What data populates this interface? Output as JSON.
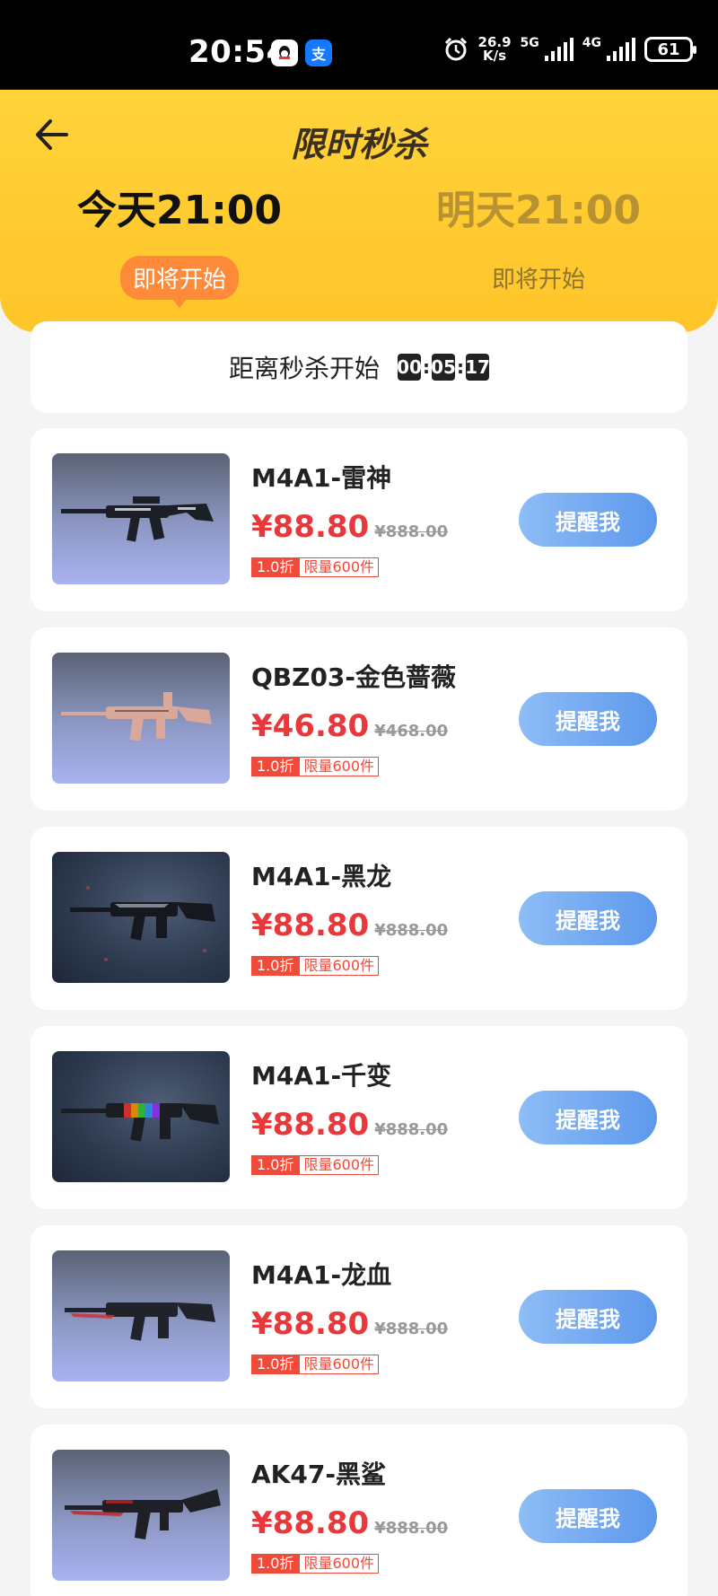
{
  "status_bar": {
    "time": "20:54",
    "qq_icon": "qq-app-icon",
    "alipay_label": "支",
    "net_speed_value": "26.9",
    "net_speed_unit": "K/s",
    "signal_1": "5G",
    "signal_2": "4G",
    "battery": "61"
  },
  "header": {
    "title": "限时秒杀",
    "sessions": [
      {
        "time": "今天21:00",
        "status": "即将开始",
        "active": true
      },
      {
        "time": "明天21:00",
        "status": "即将开始",
        "active": false
      }
    ]
  },
  "countdown": {
    "label": "距离秒杀开始",
    "hours": "00",
    "minutes": "05",
    "seconds": "17"
  },
  "products": [
    {
      "name": "M4A1-雷神",
      "price": "¥88.80",
      "original_price": "¥888.00",
      "discount": "1.0折",
      "limit": "限量600件",
      "button": "提醒我"
    },
    {
      "name": "QBZ03-金色蔷薇",
      "price": "¥46.80",
      "original_price": "¥468.00",
      "discount": "1.0折",
      "limit": "限量600件",
      "button": "提醒我"
    },
    {
      "name": "M4A1-黑龙",
      "price": "¥88.80",
      "original_price": "¥888.00",
      "discount": "1.0折",
      "limit": "限量600件",
      "button": "提醒我"
    },
    {
      "name": "M4A1-千变",
      "price": "¥88.80",
      "original_price": "¥888.00",
      "discount": "1.0折",
      "limit": "限量600件",
      "button": "提醒我"
    },
    {
      "name": "M4A1-龙血",
      "price": "¥88.80",
      "original_price": "¥888.00",
      "discount": "1.0折",
      "limit": "限量600件",
      "button": "提醒我"
    },
    {
      "name": "AK47-黑鲨",
      "price": "¥88.80",
      "original_price": "¥888.00",
      "discount": "1.0折",
      "limit": "限量600件",
      "button": "提醒我"
    }
  ],
  "colors": {
    "header_yellow": "#ffc52a",
    "price_red": "#e8383b",
    "button_blue": "#5d98ec",
    "status_orange": "#ff8a3a"
  }
}
